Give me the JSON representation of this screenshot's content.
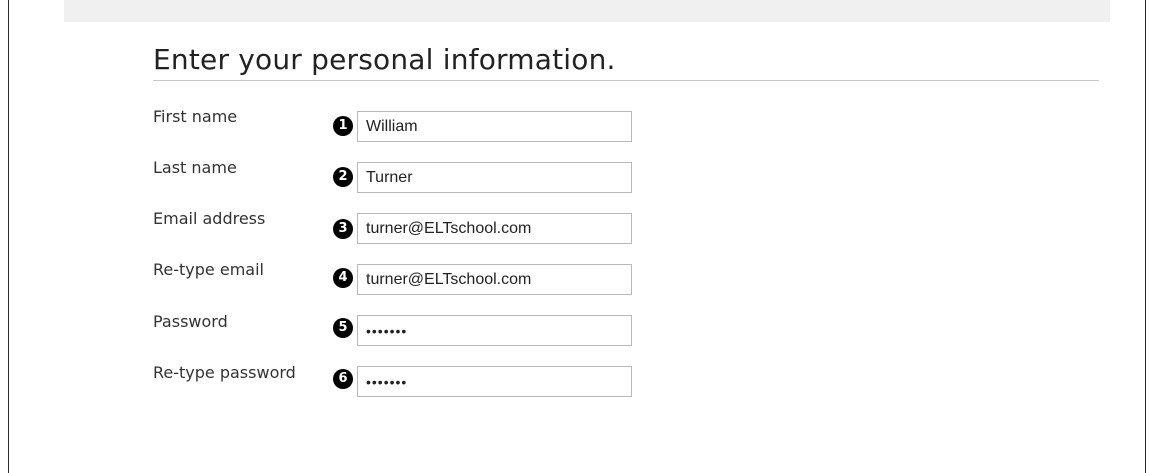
{
  "form": {
    "title": "Enter your personal information.",
    "fields": [
      {
        "label": "First name",
        "marker": "1",
        "value": "William",
        "type": "text"
      },
      {
        "label": "Last name",
        "marker": "2",
        "value": "Turner",
        "type": "text"
      },
      {
        "label": "Email address",
        "marker": "3",
        "value": "turner@ELTschool.com",
        "type": "text"
      },
      {
        "label": "Re-type email",
        "marker": "4",
        "value": "turner@ELTschool.com",
        "type": "text"
      },
      {
        "label": "Password",
        "marker": "5",
        "value": "•••••••",
        "type": "password"
      },
      {
        "label": "Re-type password",
        "marker": "6",
        "value": "•••••••",
        "type": "password"
      }
    ]
  }
}
